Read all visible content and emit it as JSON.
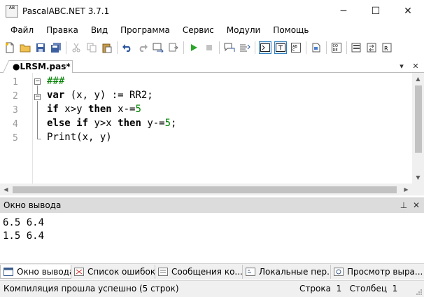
{
  "window": {
    "title": "PascalABC.NET 3.7.1",
    "icon_text": "AB",
    "controls": {
      "minimize": "─",
      "maximize": "☐",
      "close": "✕"
    }
  },
  "menu": [
    "Файл",
    "Правка",
    "Вид",
    "Программа",
    "Сервис",
    "Модули",
    "Помощь"
  ],
  "toolbar": {
    "icons": [
      "new-file-icon",
      "open-folder-icon",
      "save-icon",
      "save-all-icon",
      "cut-icon",
      "copy-icon",
      "paste-icon",
      "undo-icon",
      "redo-icon",
      "compile-icon",
      "step-icon",
      "run-icon",
      "stop-icon",
      "comment-icon",
      "format-icon",
      "console-toggle-icon",
      "text-mode-icon",
      "abc-icon",
      "file-view-icon",
      "code-icon",
      "tabs-icon",
      "arrows-icon",
      "rec-icon"
    ]
  },
  "editor_tab": {
    "label": "●LRSM.pas*",
    "dropdown": "▾",
    "close": "✕"
  },
  "editor": {
    "line_numbers": [
      "1",
      "2",
      "3",
      "4",
      "5"
    ],
    "lines": [
      [
        {
          "t": "###",
          "c": "cmt"
        }
      ],
      [
        {
          "t": "var",
          "c": "kw"
        },
        {
          "t": " (x, y) := RR2;",
          "c": "txt"
        }
      ],
      [
        {
          "t": "if",
          "c": "kw"
        },
        {
          "t": " x>y ",
          "c": "txt"
        },
        {
          "t": "then",
          "c": "kw"
        },
        {
          "t": " x-=",
          "c": "txt"
        },
        {
          "t": "5",
          "c": "num"
        }
      ],
      [
        {
          "t": "else",
          "c": "kw"
        },
        {
          "t": " ",
          "c": "txt"
        },
        {
          "t": "if",
          "c": "kw"
        },
        {
          "t": " y>x ",
          "c": "txt"
        },
        {
          "t": "then",
          "c": "kw"
        },
        {
          "t": " y-=",
          "c": "txt"
        },
        {
          "t": "5",
          "c": "num"
        },
        {
          "t": ";",
          "c": "txt"
        }
      ],
      [
        {
          "t": "Print(x, y)",
          "c": "txt"
        }
      ]
    ]
  },
  "output": {
    "title": "Окно вывода",
    "pin": "⊥",
    "close": "✕",
    "text": "6.5 6.4\n1.5 6.4"
  },
  "bottom_tabs": [
    {
      "label": "Окно вывода",
      "icon": "output-window-icon",
      "active": true
    },
    {
      "label": "Список ошибок",
      "icon": "error-list-icon",
      "active": false
    },
    {
      "label": "Сообщения ко...",
      "icon": "compiler-messages-icon",
      "active": false
    },
    {
      "label": "Локальные пер...",
      "icon": "locals-icon",
      "active": false
    },
    {
      "label": "Просмотр выра...",
      "icon": "watch-icon",
      "active": false
    }
  ],
  "status": {
    "message": "Компиляция прошла успешно (5 строк)",
    "line_label": "Строка",
    "line_value": "1",
    "col_label": "Столбец",
    "col_value": "1"
  },
  "colors": {
    "keyword": "#000000",
    "comment": "#008000",
    "number": "#008000",
    "run": "#2aa62a"
  }
}
